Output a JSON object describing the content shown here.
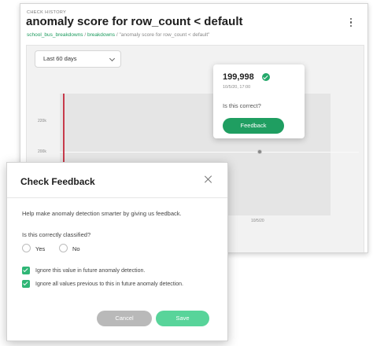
{
  "page": {
    "eyebrow": "CHECK HISTORY",
    "title": "anomaly score for row_count < default",
    "breadcrumb": {
      "link1": "school_bus_breakdowns",
      "sep1": " / ",
      "link2": "breakdowns",
      "sep2": " / ",
      "current": "\"anomaly score for row_count < default\""
    }
  },
  "range_select": {
    "value": "Last 60 days"
  },
  "chart": {
    "y_ticks": [
      "220k",
      "200k"
    ],
    "x_tick": "10/5/20"
  },
  "popup": {
    "value": "199,998",
    "timestamp": "10/5/20, 17:00",
    "question": "Is this correct?",
    "button": "Feedback"
  },
  "modal": {
    "title": "Check Feedback",
    "help": "Help make anomaly detection smarter by giving us feedback.",
    "question": "Is this correctly classified?",
    "yes": "Yes",
    "no": "No",
    "option1": "Ignore this value in future anomaly detection.",
    "option2": "Ignore all values previous to this in future anomaly detection.",
    "cancel": "Cancel",
    "save": "Save"
  },
  "colors": {
    "brand_green": "#1f9e61",
    "save_green": "#58d49a",
    "marker_red": "#c73a4b"
  }
}
